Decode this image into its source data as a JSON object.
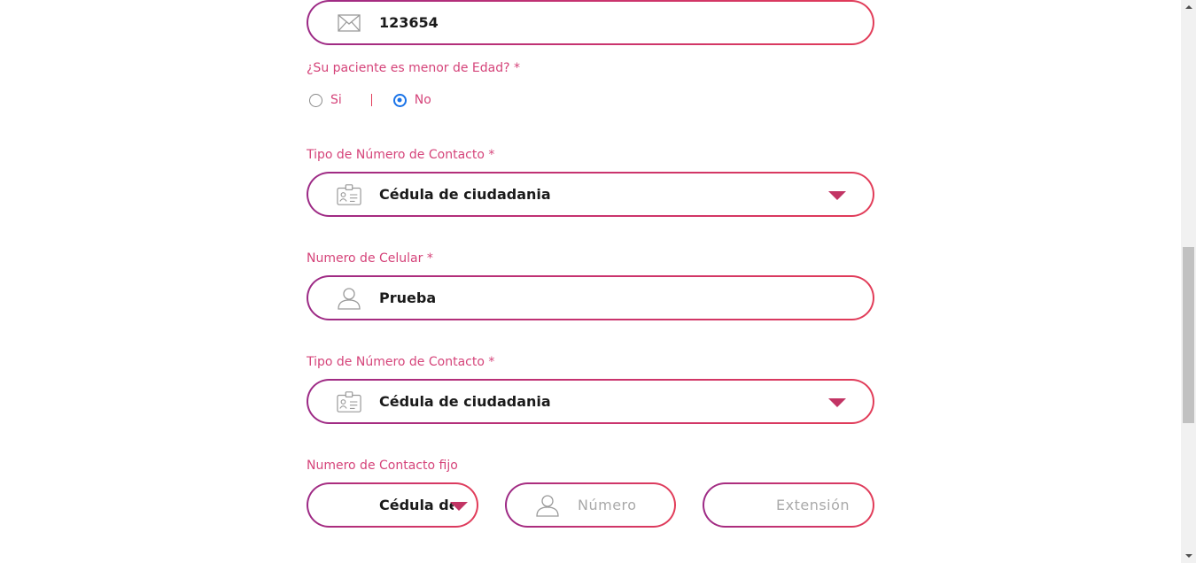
{
  "email_field": {
    "value": "123654",
    "icon": "envelope-icon"
  },
  "minor_question": {
    "label": "¿Su paciente es menor de Edad? *",
    "options": [
      {
        "label": "Si",
        "checked": false
      },
      {
        "label": "No",
        "checked": true
      }
    ]
  },
  "contact_type_1": {
    "label": "Tipo de Número de Contacto *",
    "value": "Cédula de ciudadania",
    "icon": "id-card-icon"
  },
  "cell_number": {
    "label": "Numero de Celular *",
    "value": "Prueba",
    "icon": "user-icon"
  },
  "contact_type_2": {
    "label": "Tipo de Número de Contacto *",
    "value": "Cédula de ciudadania",
    "icon": "id-card-icon"
  },
  "landline": {
    "label": "Numero de Contacto fijo",
    "type_value": "Cédula de ciudadania",
    "number_placeholder": "Número",
    "extension_placeholder": "Extensión"
  },
  "colors": {
    "label": "#d5447a",
    "border_start": "#9c2a86",
    "border_end": "#e23c58",
    "caret": "#c23464",
    "radio_checked": "#1a73e8"
  }
}
